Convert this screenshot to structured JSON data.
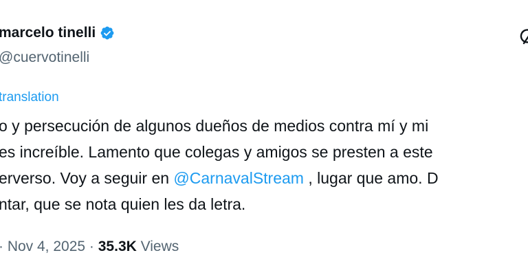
{
  "user": {
    "display_name": "marcelo tinelli",
    "handle": "@cuervotinelli"
  },
  "translation": {
    "link_text": "translation"
  },
  "tweet": {
    "line1": "o y persecución de algunos dueños de medios contra mí y mi",
    "line2": "es increíble. Lamento que colegas y amigos se presten a este",
    "line3_before": "erverso. Voy a seguir en ",
    "line3_mention": "@CarnavalStream",
    "line3_after": " , lugar que amo. D",
    "line4": "ntar, que se nota quien les da letra."
  },
  "meta": {
    "separator1": "· ",
    "date": "Nov 4, 2025",
    "separator2": " · ",
    "views_count": "35.3K",
    "views_label": " Views"
  },
  "colors": {
    "link": "#1d9bf0",
    "verified": "#1d9bf0",
    "text": "#0f1419",
    "secondary": "#536471"
  },
  "icons": {
    "verified": "verified-badge-icon",
    "more": "grok-icon"
  }
}
